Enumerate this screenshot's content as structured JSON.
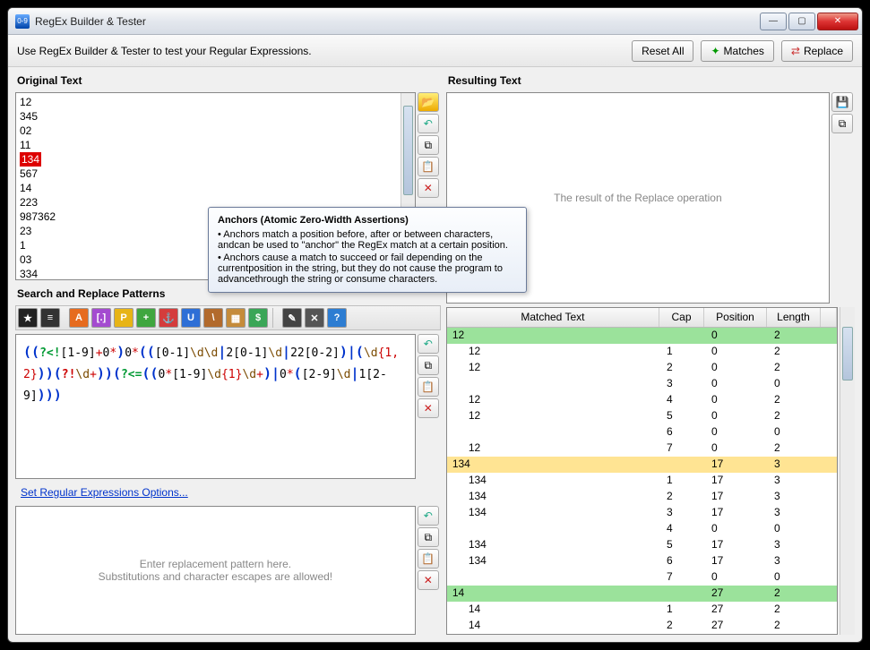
{
  "window": {
    "title": "RegEx Builder & Tester"
  },
  "topbar": {
    "instruction": "Use RegEx Builder & Tester to test your Regular Expressions.",
    "reset": "Reset All",
    "matches": "Matches",
    "replace": "Replace"
  },
  "labels": {
    "original": "Original Text",
    "resulting": "Resulting Text",
    "patterns": "Search and Replace Patterns"
  },
  "original_lines": [
    "12",
    "345",
    "02",
    "11",
    "134",
    "567",
    "14",
    "223",
    "987362",
    "23",
    "1",
    "03",
    "334"
  ],
  "original_highlight_index": 4,
  "resulting_placeholder": "The result of the Replace operation",
  "replace_placeholder": "Enter replacement pattern here.\nSubstitutions and character escapes are allowed!",
  "options_link": "Set Regular Expressions Options...",
  "pattern_raw": "((?<![1-9]+0*)0*(([0-1]\\d\\d|2[0-1]\\d|22[0-2])|(\\d{1,2}))(?!\\d+))(?<=((0*[1-9]\\d{1}\\d+)|0*([2-9]\\d|1[2-9])))",
  "tooltip": {
    "title": "Anchors (Atomic Zero-Width Assertions)",
    "b1": "• Anchors match a position before, after or between characters, andcan be used to \"anchor\" the RegEx match at a certain position.",
    "b2": "• Anchors cause a match to succeed or fail depending on the currentposition in the string, but they do not cause the program to advancethrough the string or consume characters."
  },
  "table": {
    "headers": [
      "Matched Text",
      "Cap",
      "Position",
      "Length"
    ],
    "rows": [
      {
        "text": "12",
        "cap": "",
        "pos": "0",
        "len": "2",
        "hl": "green",
        "lvl": 0
      },
      {
        "text": "12",
        "cap": "1",
        "pos": "0",
        "len": "2",
        "lvl": 1
      },
      {
        "text": "12",
        "cap": "2",
        "pos": "0",
        "len": "2",
        "lvl": 1
      },
      {
        "text": "",
        "cap": "3",
        "pos": "0",
        "len": "0",
        "lvl": 1
      },
      {
        "text": "12",
        "cap": "4",
        "pos": "0",
        "len": "2",
        "lvl": 1
      },
      {
        "text": "12",
        "cap": "5",
        "pos": "0",
        "len": "2",
        "lvl": 1
      },
      {
        "text": "",
        "cap": "6",
        "pos": "0",
        "len": "0",
        "lvl": 1
      },
      {
        "text": "12",
        "cap": "7",
        "pos": "0",
        "len": "2",
        "lvl": 1
      },
      {
        "text": "134",
        "cap": "",
        "pos": "17",
        "len": "3",
        "hl": "yellow",
        "lvl": 0
      },
      {
        "text": "134",
        "cap": "1",
        "pos": "17",
        "len": "3",
        "lvl": 1
      },
      {
        "text": "134",
        "cap": "2",
        "pos": "17",
        "len": "3",
        "lvl": 1
      },
      {
        "text": "134",
        "cap": "3",
        "pos": "17",
        "len": "3",
        "lvl": 1
      },
      {
        "text": "",
        "cap": "4",
        "pos": "0",
        "len": "0",
        "lvl": 1
      },
      {
        "text": "134",
        "cap": "5",
        "pos": "17",
        "len": "3",
        "lvl": 1
      },
      {
        "text": "134",
        "cap": "6",
        "pos": "17",
        "len": "3",
        "lvl": 1
      },
      {
        "text": "",
        "cap": "7",
        "pos": "0",
        "len": "0",
        "lvl": 1
      },
      {
        "text": "14",
        "cap": "",
        "pos": "27",
        "len": "2",
        "hl": "green",
        "lvl": 0
      },
      {
        "text": "14",
        "cap": "1",
        "pos": "27",
        "len": "2",
        "lvl": 1
      },
      {
        "text": "14",
        "cap": "2",
        "pos": "27",
        "len": "2",
        "lvl": 1
      }
    ]
  },
  "side_icons": {
    "open": "open-icon",
    "undo": "undo-icon",
    "copy": "copy-icon",
    "paste": "paste-icon",
    "delete": "delete-icon",
    "save": "save-icon",
    "clip": "clipboard-icon"
  },
  "pattern_toolbar": [
    "star",
    "text",
    "A",
    "brackets",
    "P",
    "plus",
    "anchor",
    "U",
    "slash",
    "grid",
    "dollar",
    "sep",
    "pencil",
    "tools",
    "help"
  ]
}
